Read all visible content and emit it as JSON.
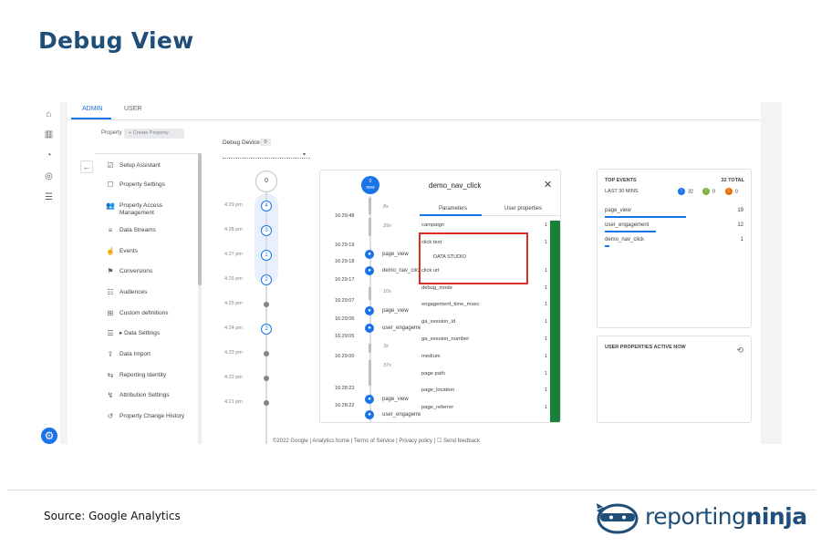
{
  "page": {
    "title": "Debug View"
  },
  "ga": {
    "tabs": [
      "ADMIN",
      "USER"
    ],
    "property_label": "Property",
    "create_property": "Create Property",
    "nav_items": [
      {
        "icon": "checkbox-icon",
        "glyph": "☑",
        "label": "Setup Assistant"
      },
      {
        "icon": "settings-icon",
        "glyph": "☐",
        "label": "Property Settings"
      },
      {
        "icon": "people-icon",
        "glyph": "👥",
        "label": "Property Access Management"
      },
      {
        "icon": "streams-icon",
        "glyph": "≡",
        "label": "Data Streams"
      },
      {
        "icon": "touch-icon",
        "glyph": "☝",
        "label": "Events"
      },
      {
        "icon": "flag-icon",
        "glyph": "⚑",
        "label": "Conversions"
      },
      {
        "icon": "audience-icon",
        "glyph": "☷",
        "label": "Audiences"
      },
      {
        "icon": "custom-definitions-icon",
        "glyph": "⊞",
        "label": "Custom definitions"
      },
      {
        "icon": "database-icon",
        "glyph": "☰",
        "label": "▸ Data Settings"
      },
      {
        "icon": "upload-icon",
        "glyph": "⇪",
        "label": "Data Import"
      },
      {
        "icon": "reporting-identity-icon",
        "glyph": "⇆",
        "label": "Reporting Identity"
      },
      {
        "icon": "attribution-icon",
        "glyph": "↯",
        "label": "Attribution Settings"
      },
      {
        "icon": "history-icon",
        "glyph": "↺",
        "label": "Property Change History"
      }
    ],
    "debug_device_label": "Debug Device",
    "debug_device_count": "0",
    "timeline_top": "0",
    "timeline": [
      {
        "time": "4:29 pm",
        "count": "4"
      },
      {
        "time": "4:28 pm",
        "count": "3"
      },
      {
        "time": "4:27 pm",
        "count": "1"
      },
      {
        "time": "4:26 pm",
        "count": "2"
      },
      {
        "time": "4:25 pm",
        "count": ""
      },
      {
        "time": "4:24 pm",
        "count": "2"
      },
      {
        "time": "4:23 pm",
        "count": ""
      },
      {
        "time": "4:22 pm",
        "count": ""
      },
      {
        "time": "4:21 pm",
        "count": ""
      }
    ],
    "stream": {
      "new_count": "0",
      "new_label": "new",
      "times": [
        "16:29:48",
        "16:29:19",
        "16:29:18",
        "16:29:17",
        "16:29:07",
        "16:29:06",
        "16:29:05",
        "16:29:00",
        "16:28:23",
        "16:28:22"
      ],
      "gaps": [
        "8s",
        "29s",
        "10s",
        "3s",
        "37s"
      ],
      "events": [
        "page_view",
        "demo_nav_click",
        "page_view",
        "user_engagement",
        "page_view",
        "user_engagement"
      ]
    },
    "params": {
      "title": "demo_nav_click",
      "tabs": [
        "Parameters",
        "User properties"
      ],
      "rows": [
        {
          "name": "campaign",
          "count": "1"
        },
        {
          "name": "click text",
          "count": "1"
        },
        {
          "name": "click url",
          "count": "1"
        },
        {
          "name": "debug_mode",
          "count": "1"
        },
        {
          "name": "engagement_time_msec",
          "count": "1"
        },
        {
          "name": "ga_session_id",
          "count": "1"
        },
        {
          "name": "ga_session_number",
          "count": "1"
        },
        {
          "name": "medium",
          "count": "1"
        },
        {
          "name": "page path",
          "count": "1"
        },
        {
          "name": "page_location",
          "count": "1"
        },
        {
          "name": "page_referrer",
          "count": "1"
        }
      ],
      "click_text_value": "DATA STUDIO"
    },
    "top_events": {
      "heading": "TOP EVENTS",
      "total": "32 TOTAL",
      "sub": "LAST 30 MINS",
      "stats": [
        {
          "icon": "info-icon",
          "value": "32",
          "color": "#1a73e8"
        },
        {
          "icon": "flag-status-icon",
          "value": "0",
          "color": "#7cb342"
        },
        {
          "icon": "error-icon",
          "value": "0",
          "color": "#e8710a"
        }
      ],
      "rows": [
        {
          "name": "page_view",
          "value": "19",
          "fraction": 0.59
        },
        {
          "name": "user_engagement",
          "value": "12",
          "fraction": 0.37
        },
        {
          "name": "demo_nav_click",
          "value": "1",
          "fraction": 0.03
        }
      ]
    },
    "user_props_heading": "USER PROPERTIES ACTIVE NOW",
    "footer": "©2022 Google | Analytics home | Terms of Service | Privacy policy | ☐ Send feedback"
  },
  "source": "Source: Google Analytics",
  "logo": {
    "part1": "reporting",
    "part2": "ninja"
  },
  "colors": {
    "title": "#1f4e79",
    "accent": "#1a73e8",
    "highlight_box": "#d93025",
    "parameter_strip": "#188038"
  }
}
